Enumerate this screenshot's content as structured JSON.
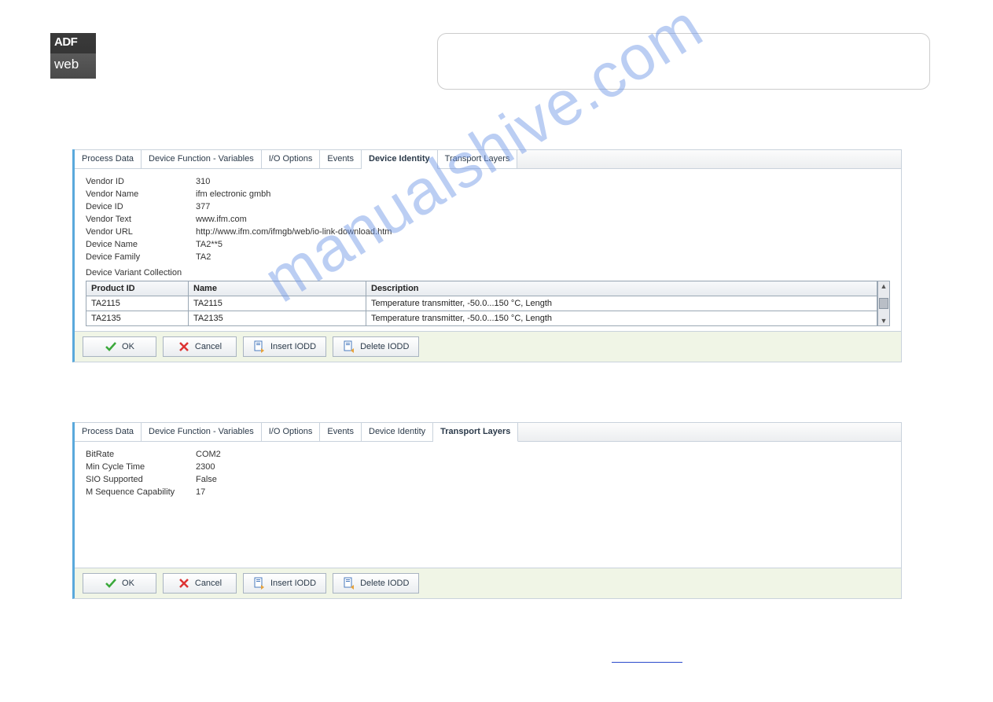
{
  "logo": {
    "line1": "ADF",
    "line2": "web"
  },
  "watermark": "manualshive.com",
  "panel1": {
    "tabs": [
      "Process Data",
      "Device Function - Variables",
      "I/O Options",
      "Events",
      "Device Identity",
      "Transport Layers"
    ],
    "activeIndex": 4,
    "fields": [
      {
        "k": "Vendor ID",
        "v": "310"
      },
      {
        "k": "Vendor Name",
        "v": "ifm electronic gmbh"
      },
      {
        "k": "Device ID",
        "v": "377"
      },
      {
        "k": "Vendor Text",
        "v": "www.ifm.com"
      },
      {
        "k": "Vendor URL",
        "v": "http://www.ifm.com/ifmgb/web/io-link-download.htm"
      },
      {
        "k": "Device Name",
        "v": "TA2**5"
      },
      {
        "k": "Device Family",
        "v": "TA2"
      }
    ],
    "collectionLabel": "Device Variant Collection",
    "table": {
      "headers": [
        "Product ID",
        "Name",
        "Description"
      ],
      "rows": [
        [
          "TA2115",
          "TA2115",
          "Temperature transmitter, -50.0...150 °C, Length"
        ],
        [
          "TA2135",
          "TA2135",
          "Temperature transmitter, -50.0...150 °C, Length"
        ]
      ]
    }
  },
  "panel2": {
    "tabs": [
      "Process Data",
      "Device Function - Variables",
      "I/O Options",
      "Events",
      "Device Identity",
      "Transport Layers"
    ],
    "activeIndex": 5,
    "fields": [
      {
        "k": "BitRate",
        "v": "COM2"
      },
      {
        "k": "Min Cycle Time",
        "v": "2300"
      },
      {
        "k": "SIO Supported",
        "v": "False"
      },
      {
        "k": "M Sequence Capability",
        "v": "17"
      }
    ]
  },
  "buttons": {
    "ok": "OK",
    "cancel": "Cancel",
    "insert": "Insert IODD",
    "delete": "Delete IODD"
  }
}
